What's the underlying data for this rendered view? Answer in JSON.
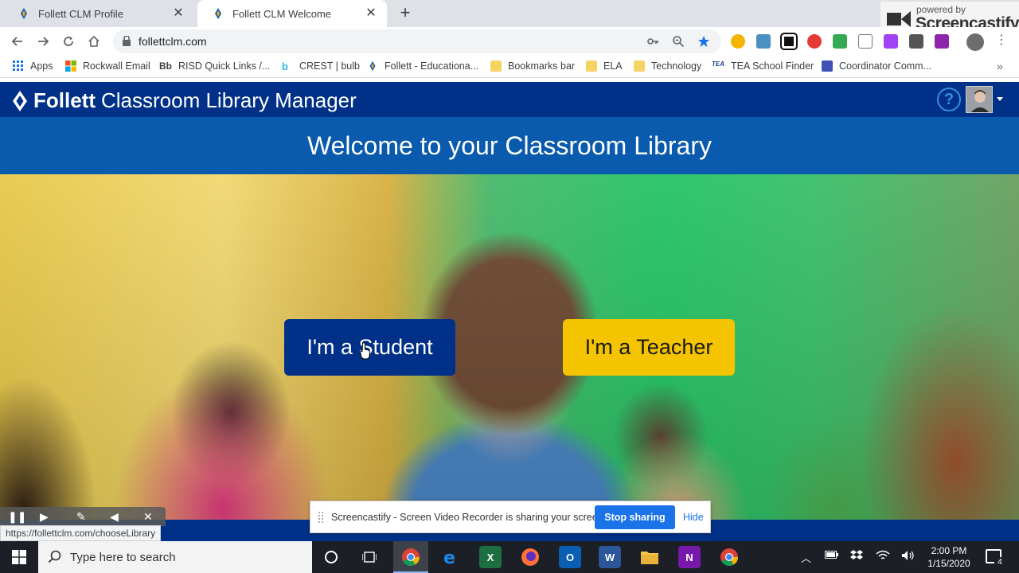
{
  "browser": {
    "tabs": [
      {
        "title": "Follett CLM Profile",
        "active": false
      },
      {
        "title": "Follett CLM Welcome",
        "active": true
      }
    ],
    "address": "follettclm.com",
    "bookmarks": [
      {
        "label": "Apps",
        "icon": "apps-grid-icon"
      },
      {
        "label": "Rockwall Email",
        "icon": "microsoft-icon"
      },
      {
        "label": "RISD Quick Links /...",
        "icon": "blackboard-icon"
      },
      {
        "label": "CREST | bulb",
        "icon": "bulb-icon"
      },
      {
        "label": "Follett - Educationa...",
        "icon": "follett-icon"
      },
      {
        "label": "Bookmarks bar",
        "icon": "folder-icon"
      },
      {
        "label": "ELA",
        "icon": "folder-icon"
      },
      {
        "label": "Technology",
        "icon": "folder-icon"
      },
      {
        "label": "TEA School Finder",
        "icon": "tea-icon"
      },
      {
        "label": "Coordinator Comm...",
        "icon": "forms-icon"
      }
    ],
    "status_url": "https://follettclm.com/chooseLibrary"
  },
  "screencastify": {
    "powered_by": "powered by",
    "brand": "Screencastify",
    "share_message": "Screencastify - Screen Video Recorder is sharing your screen.",
    "stop_label": "Stop sharing",
    "hide_label": "Hide"
  },
  "app": {
    "brand": "Follett",
    "product": "Classroom Library Manager",
    "help_glyph": "?",
    "welcome_title": "Welcome to your Classroom Library",
    "student_label": "I'm a Student",
    "teacher_label": "I'm a Teacher",
    "colors": {
      "header": "#003087",
      "band": "#0a5aad",
      "student": "#003087",
      "teacher": "#f5c400"
    }
  },
  "taskbar": {
    "search_placeholder": "Type here to search",
    "time": "2:00 PM",
    "date": "1/15/2020",
    "notification_count": "4"
  }
}
